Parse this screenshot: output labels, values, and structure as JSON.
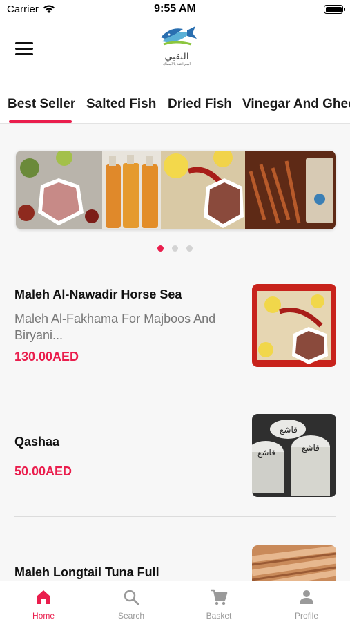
{
  "status_bar": {
    "carrier": "Carrier",
    "time": "9:55 AM"
  },
  "header": {
    "logo_arabic": "النقبي",
    "logo_tagline": "أسم الثقة بالأسماك"
  },
  "tabs": [
    {
      "label": "Best Seller",
      "active": true
    },
    {
      "label": "Salted Fish",
      "active": false
    },
    {
      "label": "Dried Fish",
      "active": false
    },
    {
      "label": "Vinegar And Ghee",
      "active": false
    }
  ],
  "carousel": {
    "slides": 3,
    "active_index": 0
  },
  "products": [
    {
      "name": "Maleh Al-Nawadir Horse Sea",
      "description": "Maleh Al-Fakhama For Majboos And Biryani...",
      "price": "130.00AED",
      "image": "salted-fish-platter"
    },
    {
      "name": "Qashaa",
      "description": "",
      "price": "50.00AED",
      "image": "qashaa-jars",
      "jar_label": "قاشع"
    },
    {
      "name": "Maleh Longtail Tuna Full",
      "description": "",
      "price": "",
      "image": "longtail-tuna"
    }
  ],
  "bottom_nav": [
    {
      "label": "Home",
      "icon": "home-icon",
      "active": true
    },
    {
      "label": "Search",
      "icon": "search-icon",
      "active": false
    },
    {
      "label": "Basket",
      "icon": "cart-icon",
      "active": false
    },
    {
      "label": "Profile",
      "icon": "profile-icon",
      "active": false
    }
  ],
  "colors": {
    "accent": "#ea1e4d",
    "inactive": "#9a9a9a",
    "background": "#f7f7f7"
  }
}
